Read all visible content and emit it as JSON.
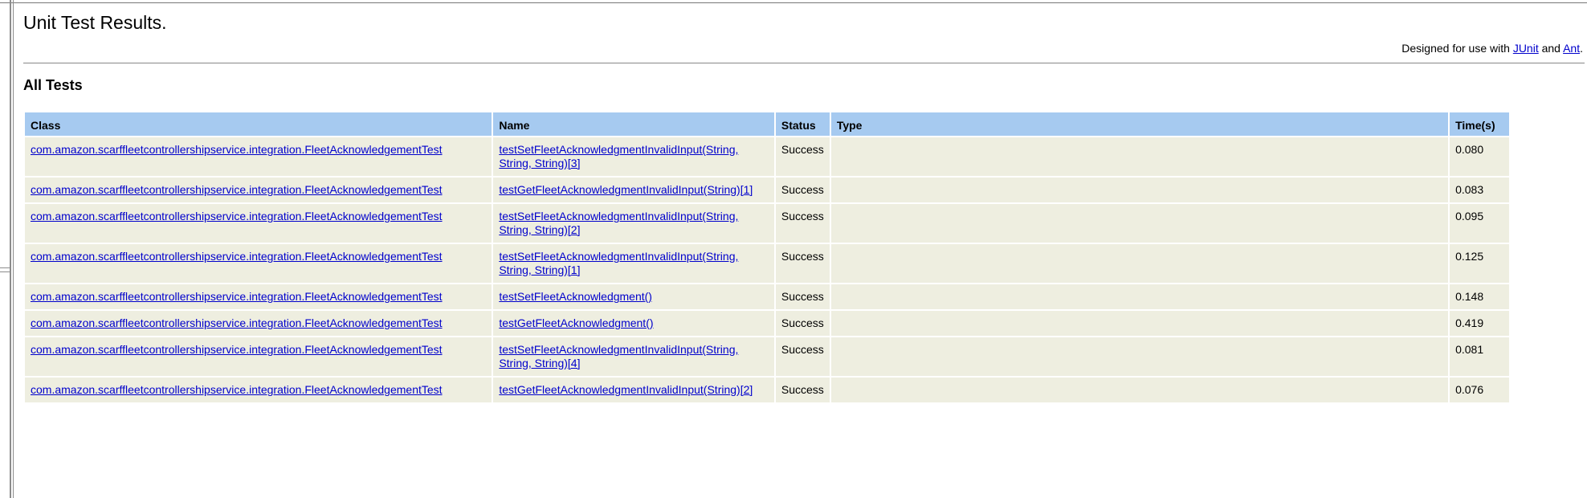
{
  "title": "Unit Test Results.",
  "designed": {
    "prefix": "Designed for use with ",
    "junit": "JUnit",
    "and": " and ",
    "ant": "Ant",
    "suffix": "."
  },
  "section_title": "All Tests",
  "columns": [
    "Class",
    "Name",
    "Status",
    "Type",
    "Time(s)"
  ],
  "rows": [
    {
      "class": "com.amazon.scarffleetcontrollershipservice.integration.FleetAcknowledgementTest",
      "name": "testSetFleetAcknowledgmentInvalidInput(String, String, String)[3]",
      "status": "Success",
      "type": "",
      "time": "0.080"
    },
    {
      "class": "com.amazon.scarffleetcontrollershipservice.integration.FleetAcknowledgementTest",
      "name": "testGetFleetAcknowledgmentInvalidInput(String)[1]",
      "status": "Success",
      "type": "",
      "time": "0.083"
    },
    {
      "class": "com.amazon.scarffleetcontrollershipservice.integration.FleetAcknowledgementTest",
      "name": "testSetFleetAcknowledgmentInvalidInput(String, String, String)[2]",
      "status": "Success",
      "type": "",
      "time": "0.095"
    },
    {
      "class": "com.amazon.scarffleetcontrollershipservice.integration.FleetAcknowledgementTest",
      "name": "testSetFleetAcknowledgmentInvalidInput(String, String, String)[1]",
      "status": "Success",
      "type": "",
      "time": "0.125"
    },
    {
      "class": "com.amazon.scarffleetcontrollershipservice.integration.FleetAcknowledgementTest",
      "name": "testSetFleetAcknowledgment()",
      "status": "Success",
      "type": "",
      "time": "0.148"
    },
    {
      "class": "com.amazon.scarffleetcontrollershipservice.integration.FleetAcknowledgementTest",
      "name": "testGetFleetAcknowledgment()",
      "status": "Success",
      "type": "",
      "time": "0.419"
    },
    {
      "class": "com.amazon.scarffleetcontrollershipservice.integration.FleetAcknowledgementTest",
      "name": "testSetFleetAcknowledgmentInvalidInput(String, String, String)[4]",
      "status": "Success",
      "type": "",
      "time": "0.081"
    },
    {
      "class": "com.amazon.scarffleetcontrollershipservice.integration.FleetAcknowledgementTest",
      "name": "testGetFleetAcknowledgmentInvalidInput(String)[2]",
      "status": "Success",
      "type": "",
      "time": "0.076"
    }
  ],
  "colors": {
    "header_bg": "#a6caf0",
    "row_bg": "#eeeee0",
    "link": "#0000cc"
  }
}
